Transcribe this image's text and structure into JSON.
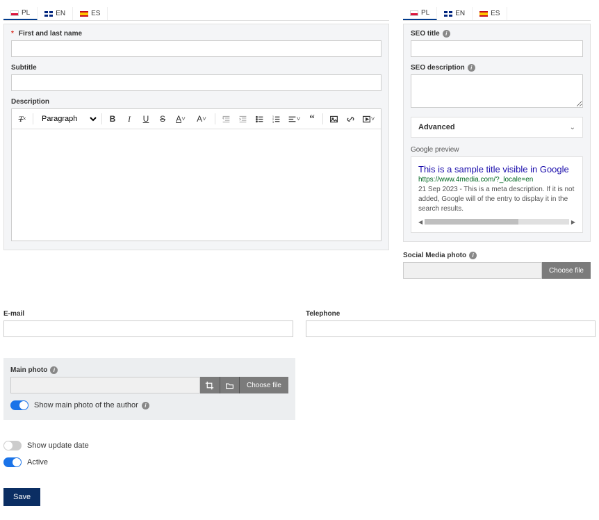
{
  "lang_tabs": {
    "pl": "PL",
    "en": "EN",
    "es": "ES"
  },
  "left": {
    "first_last_label": "First and last name",
    "subtitle_label": "Subtitle",
    "description_label": "Description",
    "paragraph_option": "Paragraph"
  },
  "seo": {
    "title_label": "SEO title",
    "desc_label": "SEO description",
    "advanced_label": "Advanced",
    "gp_label": "Google preview",
    "gp_title": "This is a sample title visible in Google",
    "gp_url": "https://www.4media.com/?_locale=en",
    "gp_desc": "21 Sep 2023 - This is a meta description. If it is not added, Google will of the entry to display it in the search results."
  },
  "sm_photo_label": "Social Media photo",
  "choose_file": "Choose file",
  "lower": {
    "email_label": "E-mail",
    "tel_label": "Telephone"
  },
  "main_photo": {
    "label": "Main photo",
    "show_label": "Show main photo of the author"
  },
  "toggles": {
    "show_update": "Show update date",
    "active": "Active"
  },
  "save": "Save"
}
